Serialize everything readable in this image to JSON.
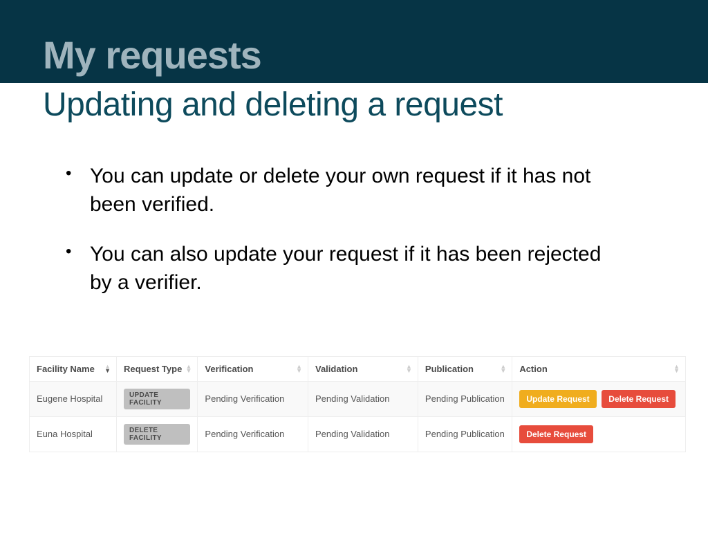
{
  "header": {
    "title": "My requests"
  },
  "subtitle": "Updating and deleting a request",
  "bullets": [
    "You can update or delete your own request if it has not been verified.",
    "You can also update your request if it has been rejected by a verifier."
  ],
  "table": {
    "headers": {
      "facility": "Facility Name",
      "type": "Request Type",
      "verification": "Verification",
      "validation": "Validation",
      "publication": "Publication",
      "action": "Action"
    },
    "rows": [
      {
        "facility": "Eugene Hospital",
        "type_badge": "UPDATE FACILITY",
        "verification": "Pending Verification",
        "validation": "Pending Validation",
        "publication": "Pending Publication",
        "update_label": "Update Request",
        "delete_label": "Delete Request",
        "show_update": true
      },
      {
        "facility": "Euna Hospital",
        "type_badge": "DELETE FACILITY",
        "verification": "Pending Verification",
        "validation": "Pending Validation",
        "publication": "Pending Publication",
        "update_label": "",
        "delete_label": "Delete Request",
        "show_update": false
      }
    ]
  }
}
